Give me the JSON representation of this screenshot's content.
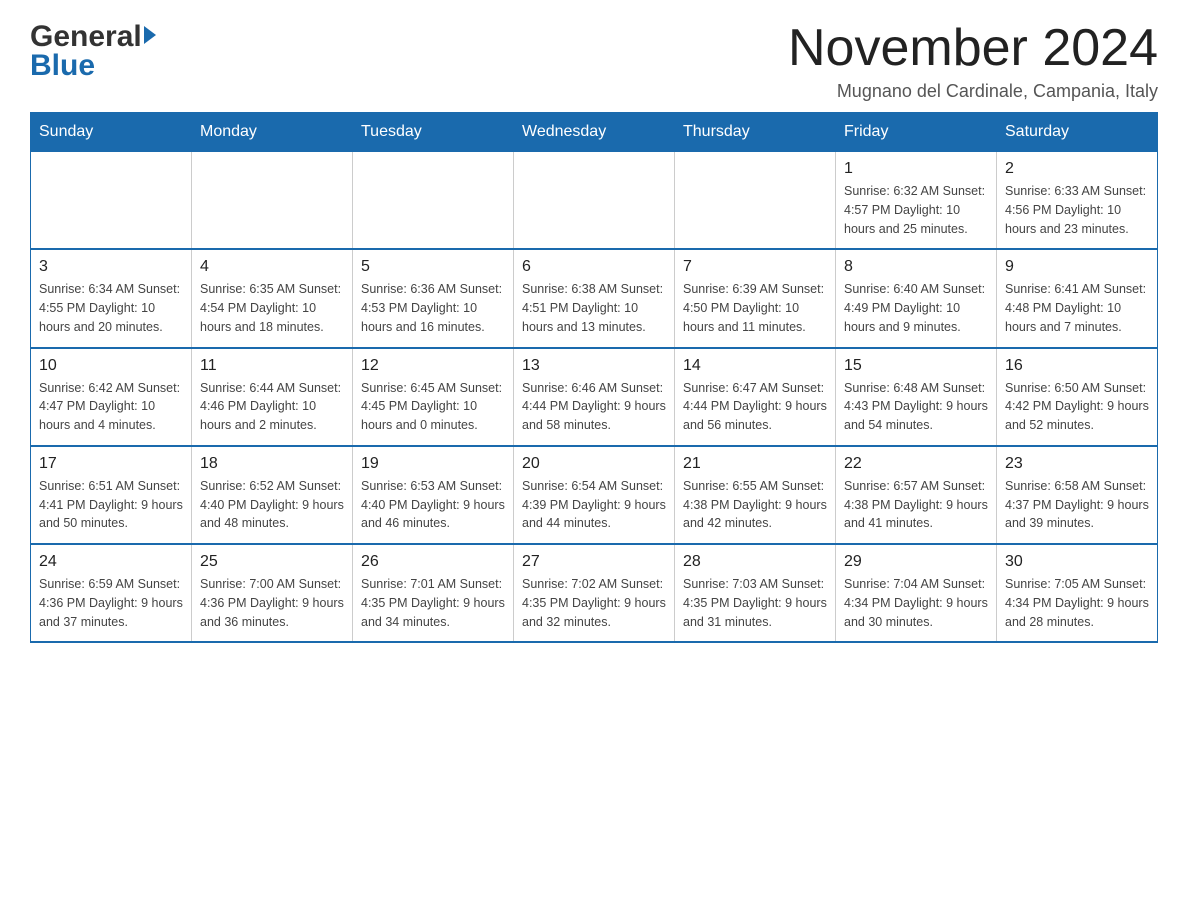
{
  "header": {
    "logo_general": "General",
    "logo_blue": "Blue",
    "calendar_title": "November 2024",
    "calendar_subtitle": "Mugnano del Cardinale, Campania, Italy"
  },
  "weekdays": [
    "Sunday",
    "Monday",
    "Tuesday",
    "Wednesday",
    "Thursday",
    "Friday",
    "Saturday"
  ],
  "weeks": [
    [
      {
        "day": "",
        "info": ""
      },
      {
        "day": "",
        "info": ""
      },
      {
        "day": "",
        "info": ""
      },
      {
        "day": "",
        "info": ""
      },
      {
        "day": "",
        "info": ""
      },
      {
        "day": "1",
        "info": "Sunrise: 6:32 AM\nSunset: 4:57 PM\nDaylight: 10 hours and 25 minutes."
      },
      {
        "day": "2",
        "info": "Sunrise: 6:33 AM\nSunset: 4:56 PM\nDaylight: 10 hours and 23 minutes."
      }
    ],
    [
      {
        "day": "3",
        "info": "Sunrise: 6:34 AM\nSunset: 4:55 PM\nDaylight: 10 hours and 20 minutes."
      },
      {
        "day": "4",
        "info": "Sunrise: 6:35 AM\nSunset: 4:54 PM\nDaylight: 10 hours and 18 minutes."
      },
      {
        "day": "5",
        "info": "Sunrise: 6:36 AM\nSunset: 4:53 PM\nDaylight: 10 hours and 16 minutes."
      },
      {
        "day": "6",
        "info": "Sunrise: 6:38 AM\nSunset: 4:51 PM\nDaylight: 10 hours and 13 minutes."
      },
      {
        "day": "7",
        "info": "Sunrise: 6:39 AM\nSunset: 4:50 PM\nDaylight: 10 hours and 11 minutes."
      },
      {
        "day": "8",
        "info": "Sunrise: 6:40 AM\nSunset: 4:49 PM\nDaylight: 10 hours and 9 minutes."
      },
      {
        "day": "9",
        "info": "Sunrise: 6:41 AM\nSunset: 4:48 PM\nDaylight: 10 hours and 7 minutes."
      }
    ],
    [
      {
        "day": "10",
        "info": "Sunrise: 6:42 AM\nSunset: 4:47 PM\nDaylight: 10 hours and 4 minutes."
      },
      {
        "day": "11",
        "info": "Sunrise: 6:44 AM\nSunset: 4:46 PM\nDaylight: 10 hours and 2 minutes."
      },
      {
        "day": "12",
        "info": "Sunrise: 6:45 AM\nSunset: 4:45 PM\nDaylight: 10 hours and 0 minutes."
      },
      {
        "day": "13",
        "info": "Sunrise: 6:46 AM\nSunset: 4:44 PM\nDaylight: 9 hours and 58 minutes."
      },
      {
        "day": "14",
        "info": "Sunrise: 6:47 AM\nSunset: 4:44 PM\nDaylight: 9 hours and 56 minutes."
      },
      {
        "day": "15",
        "info": "Sunrise: 6:48 AM\nSunset: 4:43 PM\nDaylight: 9 hours and 54 minutes."
      },
      {
        "day": "16",
        "info": "Sunrise: 6:50 AM\nSunset: 4:42 PM\nDaylight: 9 hours and 52 minutes."
      }
    ],
    [
      {
        "day": "17",
        "info": "Sunrise: 6:51 AM\nSunset: 4:41 PM\nDaylight: 9 hours and 50 minutes."
      },
      {
        "day": "18",
        "info": "Sunrise: 6:52 AM\nSunset: 4:40 PM\nDaylight: 9 hours and 48 minutes."
      },
      {
        "day": "19",
        "info": "Sunrise: 6:53 AM\nSunset: 4:40 PM\nDaylight: 9 hours and 46 minutes."
      },
      {
        "day": "20",
        "info": "Sunrise: 6:54 AM\nSunset: 4:39 PM\nDaylight: 9 hours and 44 minutes."
      },
      {
        "day": "21",
        "info": "Sunrise: 6:55 AM\nSunset: 4:38 PM\nDaylight: 9 hours and 42 minutes."
      },
      {
        "day": "22",
        "info": "Sunrise: 6:57 AM\nSunset: 4:38 PM\nDaylight: 9 hours and 41 minutes."
      },
      {
        "day": "23",
        "info": "Sunrise: 6:58 AM\nSunset: 4:37 PM\nDaylight: 9 hours and 39 minutes."
      }
    ],
    [
      {
        "day": "24",
        "info": "Sunrise: 6:59 AM\nSunset: 4:36 PM\nDaylight: 9 hours and 37 minutes."
      },
      {
        "day": "25",
        "info": "Sunrise: 7:00 AM\nSunset: 4:36 PM\nDaylight: 9 hours and 36 minutes."
      },
      {
        "day": "26",
        "info": "Sunrise: 7:01 AM\nSunset: 4:35 PM\nDaylight: 9 hours and 34 minutes."
      },
      {
        "day": "27",
        "info": "Sunrise: 7:02 AM\nSunset: 4:35 PM\nDaylight: 9 hours and 32 minutes."
      },
      {
        "day": "28",
        "info": "Sunrise: 7:03 AM\nSunset: 4:35 PM\nDaylight: 9 hours and 31 minutes."
      },
      {
        "day": "29",
        "info": "Sunrise: 7:04 AM\nSunset: 4:34 PM\nDaylight: 9 hours and 30 minutes."
      },
      {
        "day": "30",
        "info": "Sunrise: 7:05 AM\nSunset: 4:34 PM\nDaylight: 9 hours and 28 minutes."
      }
    ]
  ]
}
